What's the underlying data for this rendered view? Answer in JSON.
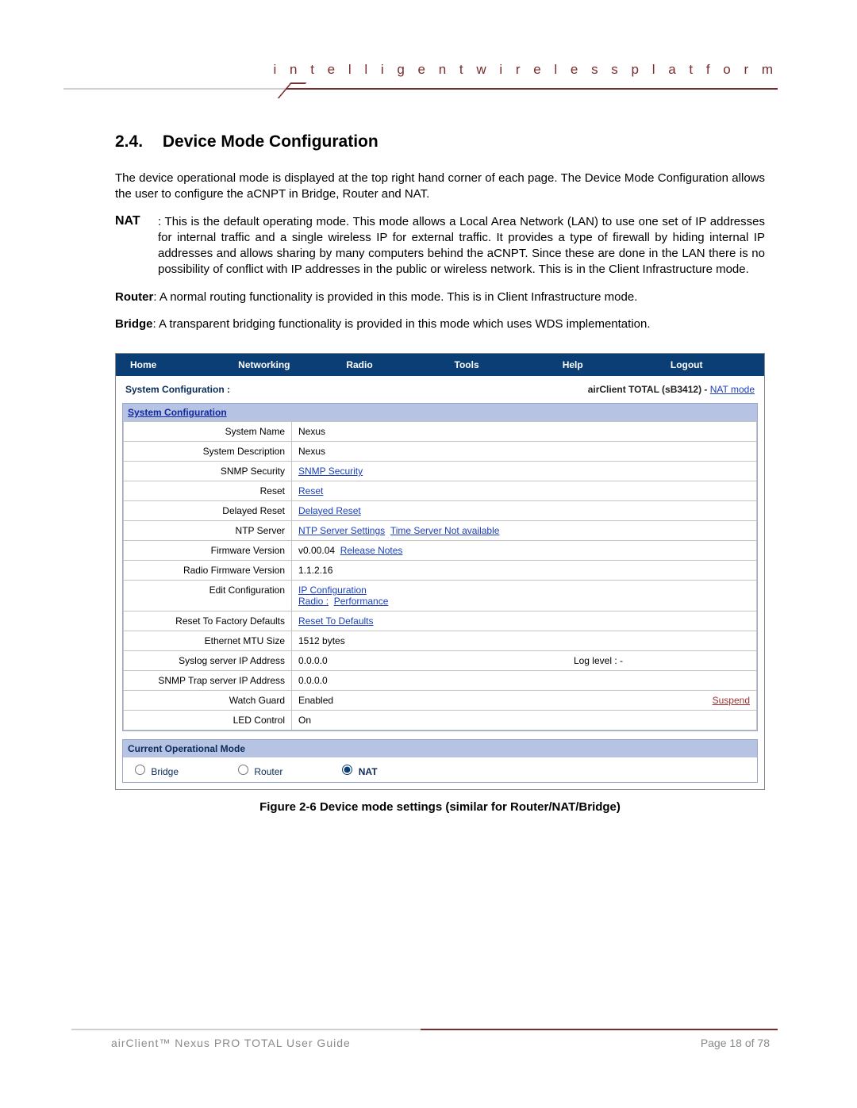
{
  "header": {
    "tagline": "i n t e l l i g e n t    w i r e l e s s    p l a t f o r m"
  },
  "section": {
    "number": "2.4.",
    "title": "Device Mode Configuration"
  },
  "intro": "The device operational mode is displayed at the top right hand corner of each page. The Device Mode Configuration allows the user to configure the aCNPT in Bridge, Router and NAT.",
  "defs": {
    "nat_label": "NAT",
    "nat_body": ":   This is the default operating mode. This mode allows a Local Area Network (LAN) to use one set of IP addresses for internal traffic and a single wireless IP for external traffic. It provides a type of firewall by hiding internal IP addresses and allows sharing by many computers behind the aCNPT. Since these are done in the LAN there is no possibility of conflict with IP addresses in the public or wireless network. This is in the Client Infrastructure mode.",
    "router_label": "Router",
    "router_body": ": A normal routing functionality is provided in this mode. This is in Client Infrastructure mode.",
    "bridge_label": "Bridge",
    "bridge_body": ": A transparent bridging functionality is provided in this mode which uses WDS implementation."
  },
  "ui": {
    "nav": {
      "home": "Home",
      "networking": "Networking",
      "radio": "Radio",
      "tools": "Tools",
      "help": "Help",
      "logout": "Logout"
    },
    "subhead_left": "System Configuration :",
    "subhead_model": "airClient TOTAL (sB3412) - ",
    "subhead_link": "NAT mode",
    "panel_title": "System Configuration",
    "rows": {
      "system_name_k": "System Name",
      "system_name_v": "Nexus",
      "system_desc_k": "System Description",
      "system_desc_v": "Nexus",
      "snmp_k": "SNMP Security",
      "snmp_link": "SNMP Security",
      "reset_k": "Reset",
      "reset_link": "Reset",
      "dreset_k": "Delayed Reset",
      "dreset_link": "Delayed Reset",
      "ntp_k": "NTP Server",
      "ntp_link1": "NTP Server Settings",
      "ntp_link2": "Time Server Not available",
      "fw_k": "Firmware Version",
      "fw_v": "v0.00.04",
      "fw_link": "Release Notes",
      "rfw_k": "Radio Firmware Version",
      "rfw_v": "1.1.2.16",
      "edit_k": "Edit Configuration",
      "edit_ip": "IP Configuration",
      "edit_radio": "Radio :",
      "edit_perf": "Performance",
      "factory_k": "Reset To Factory Defaults",
      "factory_link": "Reset To Defaults",
      "mtu_k": "Ethernet MTU Size",
      "mtu_v": "1512 bytes",
      "syslog_k": "Syslog server IP Address",
      "syslog_v": "0.0.0.0",
      "syslog_log": "Log level : -",
      "trap_k": "SNMP Trap server IP Address",
      "trap_v": "0.0.0.0",
      "watch_k": "Watch Guard",
      "watch_v": "Enabled",
      "watch_link": "Suspend",
      "led_k": "LED Control",
      "led_v": "On"
    },
    "mode_title": "Current Operational Mode",
    "modes": {
      "bridge": "Bridge",
      "router": "Router",
      "nat": "NAT"
    }
  },
  "caption": "Figure 2-6 Device mode settings (similar for Router/NAT/Bridge)",
  "footer": {
    "guide": "airClient™ Nexus PRO TOTAL User Guide",
    "page": "Page 18 of 78"
  }
}
